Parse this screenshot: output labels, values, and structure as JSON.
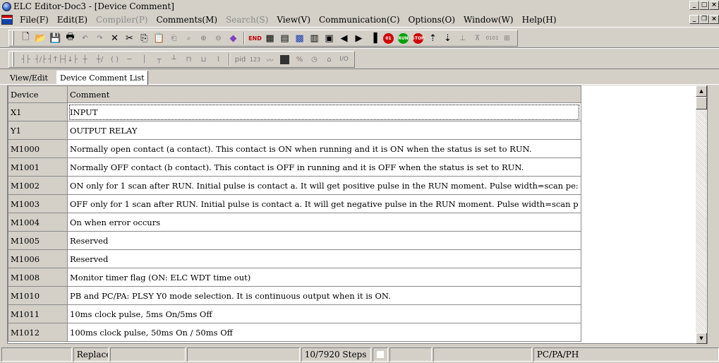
{
  "window": {
    "title": "ELC Editor-Doc3 - [Device Comment]"
  },
  "menu": [
    {
      "label": "File(F)",
      "enabled": true
    },
    {
      "label": "Edit(E)",
      "enabled": true
    },
    {
      "label": "Compiler(P)",
      "enabled": false
    },
    {
      "label": "Comments(M)",
      "enabled": true
    },
    {
      "label": "Search(S)",
      "enabled": false
    },
    {
      "label": "View(V)",
      "enabled": true
    },
    {
      "label": "Communication(C)",
      "enabled": true
    },
    {
      "label": "Options(O)",
      "enabled": true
    },
    {
      "label": "Window(W)",
      "enabled": true
    },
    {
      "label": "Help(H)",
      "enabled": true
    }
  ],
  "toolbar2_text": {
    "pid": "pid",
    "digits": "123"
  },
  "tabs": [
    {
      "label": "View/Edit",
      "active": false
    },
    {
      "label": "Device Comment List",
      "active": true
    }
  ],
  "grid": {
    "headers": {
      "device": "Device",
      "comment": "Comment"
    },
    "rows": [
      {
        "device": "X1",
        "comment": "INPUT"
      },
      {
        "device": "Y1",
        "comment": "OUTPUT RELAY"
      },
      {
        "device": "M1000",
        "comment": "Normally open contact (a contact). This contact is ON when running and it is ON when the status is set to RUN."
      },
      {
        "device": "M1001",
        "comment": "Normally OFF contact (b contact). This contact is OFF in running and it is OFF when the status is set to RUN."
      },
      {
        "device": "M1002",
        "comment": "ON only for 1 scan after RUN. Initial pulse is contact a. It will get positive pulse in the RUN moment. Pulse width=scan pe:"
      },
      {
        "device": "M1003",
        "comment": "OFF only for 1 scan after RUN. Initial pulse is contact a. It will get negative pulse in the RUN moment. Pulse width=scan p"
      },
      {
        "device": "M1004",
        "comment": "On when error occurs"
      },
      {
        "device": "M1005",
        "comment": "Reserved"
      },
      {
        "device": "M1006",
        "comment": "Reserved"
      },
      {
        "device": "M1008",
        "comment": "Monitor timer flag (ON: ELC WDT time out)"
      },
      {
        "device": "M1010",
        "comment": "PB and PC/PA: PLSY Y0 mode selection. It is continuous output when it is ON."
      },
      {
        "device": "M1011",
        "comment": "10ms clock pulse, 5ms On/5ms Off"
      },
      {
        "device": "M1012",
        "comment": "100ms clock pulse, 50ms On / 50ms Off"
      }
    ]
  },
  "status": {
    "mode": "Replace",
    "steps": "10/7920 Steps",
    "plc_type": "PC/PA/PH"
  }
}
